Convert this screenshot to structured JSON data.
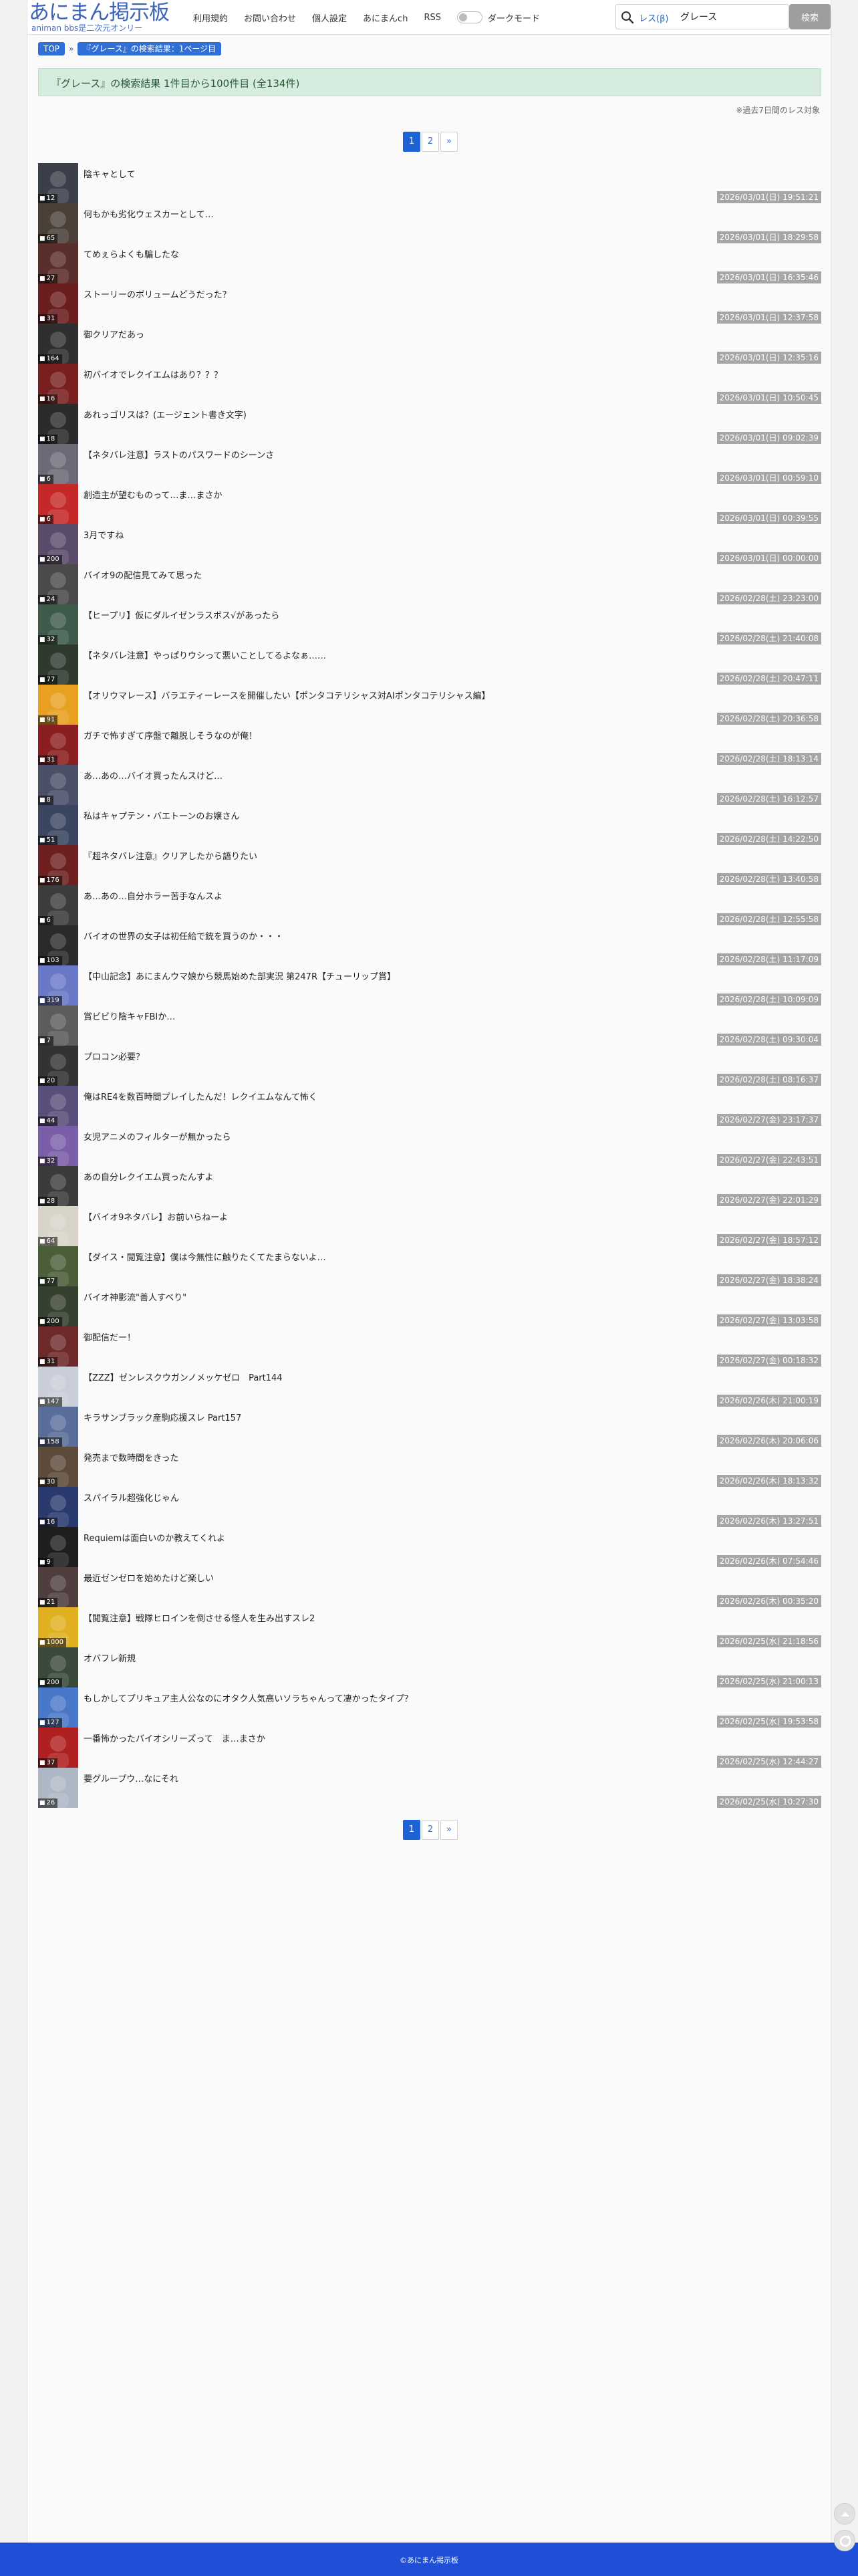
{
  "header": {
    "logo_title": "あにまん掲示板",
    "logo_sub": "animan bbs是二次元オンリー",
    "nav": [
      "利用規約",
      "お問い合わせ",
      "個人設定",
      "あにまんch",
      "RSS"
    ],
    "dark_mode_label": "ダークモード",
    "search_scope": "レス(β)",
    "search_value": "グレース",
    "search_button": "検索"
  },
  "breadcrumb": {
    "top": "TOP",
    "sep": "»",
    "current": "『グレース』の検索結果：1ページ目"
  },
  "result_summary": "『グレース』の検索結果 1件目から100件目 (全134件)",
  "note": "※過去7日間のレス対象",
  "pagination": {
    "pages": [
      "1",
      "2"
    ],
    "next": "»",
    "current": "1"
  },
  "threads": [
    {
      "title": "陰キャとして",
      "count": "12",
      "date": "2026/03/01(日) 19:51:21",
      "color": "#3b3f4a"
    },
    {
      "title": "何もかも劣化ウェスカーとして…",
      "count": "65",
      "date": "2026/03/01(日) 18:29:58",
      "color": "#4a4038"
    },
    {
      "title": "てめぇらよくも騙したな",
      "count": "27",
      "date": "2026/03/01(日) 16:35:46",
      "color": "#5a2e2a"
    },
    {
      "title": "ストーリーのボリュームどうだった？",
      "count": "31",
      "date": "2026/03/01(日) 12:37:58",
      "color": "#6b1e1e"
    },
    {
      "title": "御クリアだあっ",
      "count": "164",
      "date": "2026/03/01(日) 12:35:16",
      "color": "#2f2f2f"
    },
    {
      "title": "初バイオでレクイエムはあり？？？",
      "count": "16",
      "date": "2026/03/01(日) 10:50:45",
      "color": "#7a1f1f"
    },
    {
      "title": "あれっゴリスは？(エージェント書き文字)",
      "count": "18",
      "date": "2026/03/01(日) 09:02:39",
      "color": "#2b2b2b"
    },
    {
      "title": "【ネタバレ注意】ラストのパスワードのシーンさ",
      "count": "6",
      "date": "2026/03/01(日) 00:59:10",
      "color": "#6b6b78"
    },
    {
      "title": "創造主が望むものって…ま…まさか",
      "count": "6",
      "date": "2026/03/01(日) 00:39:55",
      "color": "#c62828"
    },
    {
      "title": "3月ですね",
      "count": "200",
      "date": "2026/03/01(日) 00:00:00",
      "color": "#5b4b6b"
    },
    {
      "title": "バイオ9の配信見てみて思った",
      "count": "24",
      "date": "2026/02/28(土) 23:23:00",
      "color": "#4a4a4a"
    },
    {
      "title": "【ヒープリ】仮にダルイゼンラスボス√があったら",
      "count": "32",
      "date": "2026/02/28(土) 21:40:08",
      "color": "#3d5a4a"
    },
    {
      "title": "【ネタバレ注意】やっぱりウシって悪いことしてるよなぁ……",
      "count": "77",
      "date": "2026/02/28(土) 20:47:11",
      "color": "#2e3a2e"
    },
    {
      "title": "【オリウマレース】バラエティーレースを開催したい【ポンタコテリシャス対AIポンタコテリシャス編】",
      "count": "91",
      "date": "2026/02/28(土) 20:36:58",
      "color": "#e8a020"
    },
    {
      "title": "ガチで怖すぎて序盤で離脱しそうなのが俺！",
      "count": "31",
      "date": "2026/02/28(土) 18:13:14",
      "color": "#8b1e1e"
    },
    {
      "title": "あ…あの…バイオ買ったんスけど…",
      "count": "8",
      "date": "2026/02/28(土) 16:12:57",
      "color": "#4b4f68"
    },
    {
      "title": "私はキャプテン・バエトーンのお嬢さん",
      "count": "51",
      "date": "2026/02/28(土) 14:22:50",
      "color": "#3a4660"
    },
    {
      "title": "『超ネタバレ注意』クリアしたから語りたい",
      "count": "176",
      "date": "2026/02/28(土) 13:40:58",
      "color": "#6e1f1f"
    },
    {
      "title": "あ…あの…自分ホラー苦手なんスよ",
      "count": "6",
      "date": "2026/02/28(土) 12:55:58",
      "color": "#3c3c3c"
    },
    {
      "title": "バイオの世界の女子は初任給で銃を買うのか・・・",
      "count": "103",
      "date": "2026/02/28(土) 11:17:09",
      "color": "#2a2a2a"
    },
    {
      "title": "【中山記念】あにまんウマ娘から競馬始めた部実況 第247R【チューリップ賞】",
      "count": "319",
      "date": "2026/02/28(土) 10:09:09",
      "color": "#6a78c8"
    },
    {
      "title": "賞ビビり陰キャFBIか…",
      "count": "7",
      "date": "2026/02/28(土) 09:30:04",
      "color": "#5c5c5c"
    },
    {
      "title": "プロコン必要？",
      "count": "20",
      "date": "2026/02/28(土) 08:16:37",
      "color": "#333333"
    },
    {
      "title": "俺はRE4を数百時間プレイしたんだ！レクイエムなんて怖く",
      "count": "44",
      "date": "2026/02/27(金) 23:17:37",
      "color": "#5a4f7a"
    },
    {
      "title": "女児アニメのフィルターが無かったら",
      "count": "32",
      "date": "2026/02/27(金) 22:43:51",
      "color": "#7a5ea8"
    },
    {
      "title": "あの自分レクイエム買ったんすよ",
      "count": "28",
      "date": "2026/02/27(金) 22:01:29",
      "color": "#3b3b3b"
    },
    {
      "title": "【バイオ9ネタバレ】お前いらねーよ",
      "count": "64",
      "date": "2026/02/27(金) 18:57:12",
      "color": "#d8d4c8"
    },
    {
      "title": "【ダイス・閲覧注意】僕は今無性に触りたくてたまらないよ…",
      "count": "77",
      "date": "2026/02/27(金) 18:38:24",
      "color": "#4a5e3a"
    },
    {
      "title": "バイオ神影流\"善人すべり\"",
      "count": "200",
      "date": "2026/02/27(金) 13:03:58",
      "color": "#35402e"
    },
    {
      "title": "御配信だー！",
      "count": "31",
      "date": "2026/02/27(金) 00:18:32",
      "color": "#6e2a2a"
    },
    {
      "title": "【ZZZ】ゼンレスクウガンノメッケゼロ　Part144",
      "count": "147",
      "date": "2026/02/26(木) 21:00:19",
      "color": "#c9ced8"
    },
    {
      "title": "キラサンブラック産駒応援スレ Part157",
      "count": "158",
      "date": "2026/02/26(木) 20:06:06",
      "color": "#5a6e9a"
    },
    {
      "title": "発売まで数時間をきった",
      "count": "30",
      "date": "2026/02/26(木) 18:13:32",
      "color": "#5c4a3a"
    },
    {
      "title": "スパイラル超強化じゃん",
      "count": "16",
      "date": "2026/02/26(木) 13:27:51",
      "color": "#2a3a6e"
    },
    {
      "title": "Requiemは面白いのか教えてくれよ",
      "count": "9",
      "date": "2026/02/26(木) 07:54:46",
      "color": "#1e1e1e"
    },
    {
      "title": "最近ゼンゼロを始めたけど楽しい",
      "count": "21",
      "date": "2026/02/26(木) 00:35:20",
      "color": "#4e3e3e"
    },
    {
      "title": "【閲覧注意】戦隊ヒロインを倒させる怪人を生み出すスレ2",
      "count": "1000",
      "date": "2026/02/25(水) 21:18:56",
      "color": "#e0b020"
    },
    {
      "title": "オバフレ新規",
      "count": "200",
      "date": "2026/02/25(水) 21:00:13",
      "color": "#3a4a3a"
    },
    {
      "title": "もしかしてプリキュア主人公なのにオタク人気高いソラちゃんって凄かったタイプ？",
      "count": "127",
      "date": "2026/02/25(水) 19:53:58",
      "color": "#4a78c8"
    },
    {
      "title": "一番怖かったバイオシリーズって　ま…まさか",
      "count": "37",
      "date": "2026/02/25(水) 12:44:27",
      "color": "#b02020"
    },
    {
      "title": "要グループウ…なにそれ",
      "count": "26",
      "date": "2026/02/25(水) 10:27:30",
      "color": "#aeb8c4"
    }
  ],
  "footer": "©あにまん掲示板"
}
